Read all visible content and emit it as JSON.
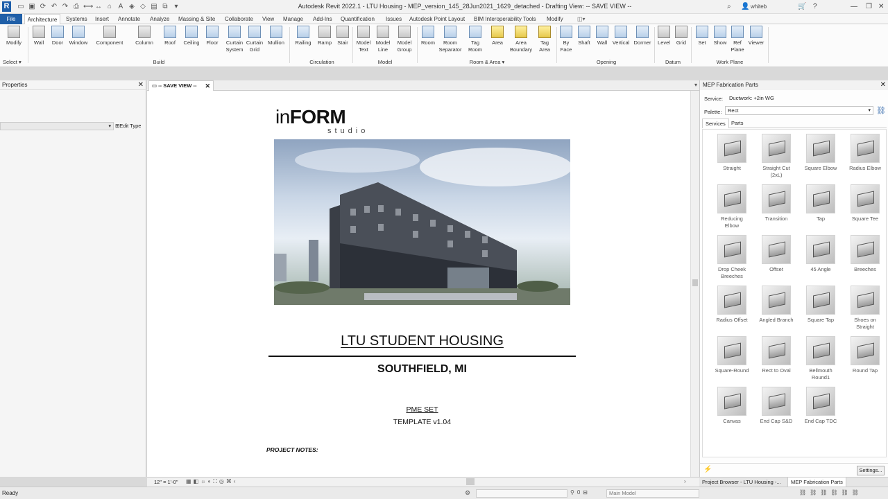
{
  "titlebar": {
    "window_title": "Autodesk Revit 2022.1 - LTU Housing - MEP_version_145_28Jun2021_1629_detached - Drafting View: -- SAVE VIEW --",
    "user": "whiteb"
  },
  "menu": {
    "tabs": [
      "File",
      "Architecture",
      "Systems",
      "Insert",
      "Annotate",
      "Analyze",
      "Massing & Site",
      "Collaborate",
      "View",
      "Manage",
      "Add-Ins",
      "Quantification",
      "Issues",
      "Autodesk Point Layout",
      "BIM Interoperability Tools",
      "Modify"
    ]
  },
  "ribbon": {
    "select_label": "Select",
    "groups": [
      "Build",
      "Circulation",
      "Model",
      "Room & Area",
      "Opening",
      "Datum",
      "Work Plane"
    ],
    "buttons": {
      "modify": "Modify",
      "wall": "Wall",
      "door": "Door",
      "window": "Window",
      "component": "Component",
      "column": "Column",
      "roof": "Roof",
      "ceiling": "Ceiling",
      "floor": "Floor",
      "curtain_system": "Curtain System",
      "curtain_grid": "Curtain Grid",
      "mullion": "Mullion",
      "railing": "Railing",
      "ramp": "Ramp",
      "stair": "Stair",
      "model_text": "Model Text",
      "model_line": "Model Line",
      "model_group": "Model Group",
      "room": "Room",
      "room_separator": "Room Separator",
      "tag_room": "Tag Room",
      "area": "Area",
      "area_boundary": "Area Boundary",
      "tag_area": "Tag Area",
      "by_face": "By Face",
      "shaft": "Shaft",
      "wall_opening": "Wall",
      "vertical": "Vertical",
      "dormer": "Dormer",
      "level": "Level",
      "grid": "Grid",
      "set": "Set",
      "show": "Show",
      "ref_plane": "Ref Plane",
      "viewer": "Viewer"
    }
  },
  "properties": {
    "title": "Properties",
    "edit_type": "Edit Type"
  },
  "view": {
    "tab_label": "-- SAVE VIEW --",
    "logo_in": "in",
    "logo_form": "FORM",
    "logo_studio": "studio",
    "project_title": "LTU STUDENT HOUSING",
    "project_location": "SOUTHFIELD, MI",
    "set_name": "PME SET",
    "template_version": "TEMPLATE v1.04",
    "notes_heading": "PROJECT NOTES:",
    "scale": "12\" = 1'-0\""
  },
  "mep_panel": {
    "title": "MEP Fabrication Parts",
    "service_label": "Service:",
    "service_value": "Ductwork: +2in WG",
    "palette_label": "Palette:",
    "palette_value": "Rect",
    "tabs": [
      "Services",
      "Parts"
    ],
    "parts": [
      [
        "Straight"
      ],
      [
        "Straight Cut",
        "(2xL)"
      ],
      [
        "Square Elbow"
      ],
      [
        "Radius Elbow"
      ],
      [
        "Reducing",
        "Elbow"
      ],
      [
        "Transition"
      ],
      [
        "Tap"
      ],
      [
        "Square Tee"
      ],
      [
        "Drop Cheek",
        "Breeches"
      ],
      [
        "Offset"
      ],
      [
        "45 Angle"
      ],
      [
        "Breeches"
      ],
      [
        "Radius Offset"
      ],
      [
        "Angled Branch"
      ],
      [
        "Square Tap"
      ],
      [
        "Shoes on",
        "Straight"
      ],
      [
        "Square-Round"
      ],
      [
        "Rect to Oval"
      ],
      [
        "Bellmouth",
        "Round1"
      ],
      [
        "Round Tap"
      ],
      [
        "Canvas"
      ],
      [
        "End Cap S&D"
      ],
      [
        "End Cap TDC"
      ]
    ],
    "settings_label": "Settings..."
  },
  "bottom_tabs": [
    "Project Browser - LTU Housing -...",
    "MEP Fabrication Parts"
  ],
  "status": {
    "text": "Ready",
    "model": "Main Model"
  }
}
